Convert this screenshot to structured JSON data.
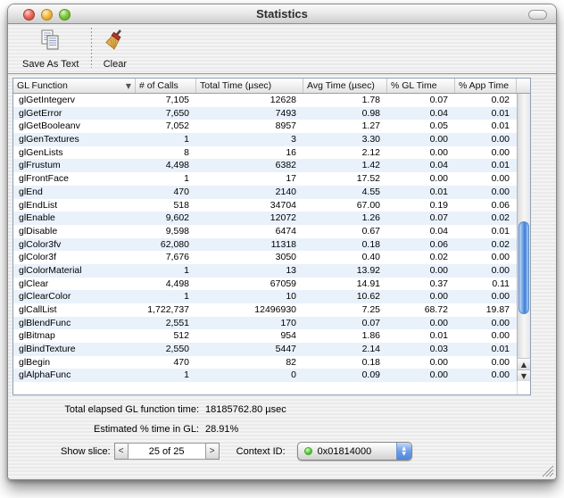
{
  "window": {
    "title": "Statistics"
  },
  "toolbar": {
    "save_label": "Save As Text",
    "clear_label": "Clear"
  },
  "table": {
    "columns": [
      "GL Function",
      "# of Calls",
      "Total Time (µsec)",
      "Avg Time (µsec)",
      "% GL Time",
      "% App Time"
    ],
    "sort": {
      "column": "GL Function",
      "direction": "descending"
    },
    "rows": [
      [
        "glGetIntegerv",
        "7,105",
        "12628",
        "1.78",
        "0.07",
        "0.02"
      ],
      [
        "glGetError",
        "7,650",
        "7493",
        "0.98",
        "0.04",
        "0.01"
      ],
      [
        "glGetBooleanv",
        "7,052",
        "8957",
        "1.27",
        "0.05",
        "0.01"
      ],
      [
        "glGenTextures",
        "1",
        "3",
        "3.30",
        "0.00",
        "0.00"
      ],
      [
        "glGenLists",
        "8",
        "16",
        "2.12",
        "0.00",
        "0.00"
      ],
      [
        "glFrustum",
        "4,498",
        "6382",
        "1.42",
        "0.04",
        "0.01"
      ],
      [
        "glFrontFace",
        "1",
        "17",
        "17.52",
        "0.00",
        "0.00"
      ],
      [
        "glEnd",
        "470",
        "2140",
        "4.55",
        "0.01",
        "0.00"
      ],
      [
        "glEndList",
        "518",
        "34704",
        "67.00",
        "0.19",
        "0.06"
      ],
      [
        "glEnable",
        "9,602",
        "12072",
        "1.26",
        "0.07",
        "0.02"
      ],
      [
        "glDisable",
        "9,598",
        "6474",
        "0.67",
        "0.04",
        "0.01"
      ],
      [
        "glColor3fv",
        "62,080",
        "11318",
        "0.18",
        "0.06",
        "0.02"
      ],
      [
        "glColor3f",
        "7,676",
        "3050",
        "0.40",
        "0.02",
        "0.00"
      ],
      [
        "glColorMaterial",
        "1",
        "13",
        "13.92",
        "0.00",
        "0.00"
      ],
      [
        "glClear",
        "4,498",
        "67059",
        "14.91",
        "0.37",
        "0.11"
      ],
      [
        "glClearColor",
        "1",
        "10",
        "10.62",
        "0.00",
        "0.00"
      ],
      [
        "glCallList",
        "1,722,737",
        "12496930",
        "7.25",
        "68.72",
        "19.87"
      ],
      [
        "glBlendFunc",
        "2,551",
        "170",
        "0.07",
        "0.00",
        "0.00"
      ],
      [
        "glBitmap",
        "512",
        "954",
        "1.86",
        "0.01",
        "0.00"
      ],
      [
        "glBindTexture",
        "2,550",
        "5447",
        "2.14",
        "0.03",
        "0.01"
      ],
      [
        "glBegin",
        "470",
        "82",
        "0.18",
        "0.00",
        "0.00"
      ],
      [
        "glAlphaFunc",
        "1",
        "0",
        "0.09",
        "0.00",
        "0.00"
      ]
    ]
  },
  "footer": {
    "total_label": "Total elapsed GL function time:",
    "total_value": "18185762.80 µsec",
    "estimated_label": "Estimated % time in GL:",
    "estimated_value": "28.91%",
    "show_slice_label": "Show slice:",
    "slice_value": "25 of 25",
    "context_label": "Context ID:",
    "context_value": "0x01814000"
  },
  "icons": {
    "sort_desc": "▼",
    "scroll_up": "▲",
    "scroll_down": "▼",
    "slice_prev": "<",
    "slice_next": ">",
    "popup_up": "▲",
    "popup_down": "▼"
  },
  "colors": {
    "row_stripe": "#e9f1fb",
    "scroll_thumb_blue": "#3c7cd6",
    "popup_stepper_blue": "#4b83d8",
    "context_status_green": "#55cf36"
  }
}
